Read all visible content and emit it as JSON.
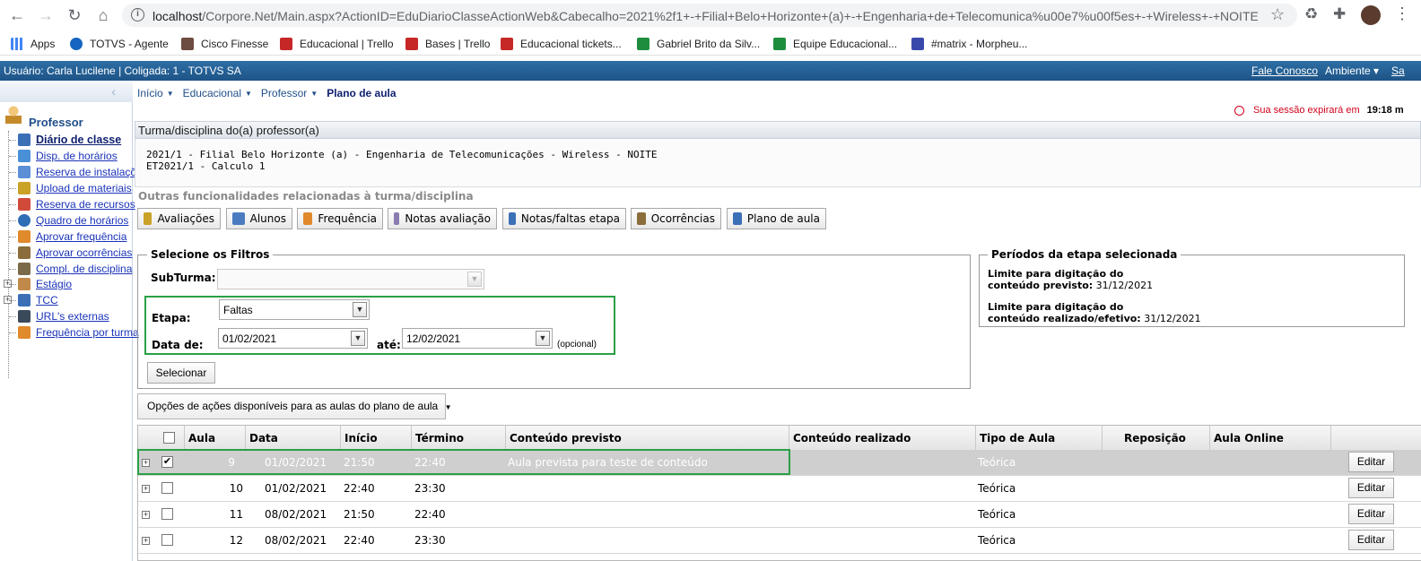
{
  "browser": {
    "url_host": "localhost",
    "url_rest": "/Corpore.Net/Main.aspx?ActionID=EduDiarioClasseActionWeb&Cabecalho=2021%2f1+-+Filial+Belo+Horizonte+(a)+-+Engenharia+de+Telecomunica%u00e7%u00f5es+-+Wireless+-+NOITE...",
    "bookmarks": [
      {
        "label": "Apps",
        "color": "#4285f4"
      },
      {
        "label": "TOTVS - Agente",
        "color": "#1565c0"
      },
      {
        "label": "Cisco Finesse",
        "color": "#6d4c41"
      },
      {
        "label": "Educacional | Trello",
        "color": "#c62828"
      },
      {
        "label": "Bases | Trello",
        "color": "#c62828"
      },
      {
        "label": "Educacional tickets...",
        "color": "#c62828"
      },
      {
        "label": "Gabriel Brito da Silv...",
        "color": "#1e8e3e"
      },
      {
        "label": "Equipe Educacional...",
        "color": "#1e8e3e"
      },
      {
        "label": "#matrix - Morpheu...",
        "color": "#3949ab"
      }
    ]
  },
  "header": {
    "user_info": "Usuário: Carla Lucilene  |  Coligada: 1 - TOTVS SA",
    "fale_conosco": "Fale Conosco",
    "ambiente": "Ambiente ▾",
    "sair": "Sa"
  },
  "sidebar": {
    "title": "Professor",
    "items": [
      {
        "label": "Diário de classe",
        "color": "#3b6fb6"
      },
      {
        "label": "Disp. de horários",
        "color": "#4a90d9"
      },
      {
        "label": "Reserva de instalaçõ",
        "color": "#5c8fd6"
      },
      {
        "label": "Upload de materiais",
        "color": "#c9a227"
      },
      {
        "label": "Reserva de recursos",
        "color": "#d04a3a"
      },
      {
        "label": "Quadro de horários",
        "color": "#2f6db5"
      },
      {
        "label": "Aprovar frequência",
        "color": "#e08a2c"
      },
      {
        "label": "Aprovar ocorrências",
        "color": "#8a6d3b"
      },
      {
        "label": "Compl. de disciplina",
        "color": "#7b6a4a"
      },
      {
        "label": "Estágio",
        "color": "#c28a4a"
      },
      {
        "label": "TCC",
        "color": "#3b6fb6"
      },
      {
        "label": "URL's externas",
        "color": "#3a4a5a"
      },
      {
        "label": "Frequência por turma",
        "color": "#e08a2c"
      }
    ]
  },
  "breadcrumb": {
    "inicio": "Início",
    "educacional": "Educacional",
    "professor": "Professor",
    "current": "Plano de aula"
  },
  "session": {
    "text": "Sua sessão expirará em",
    "time": "19:18 m"
  },
  "turma": {
    "header": "Turma/disciplina do(a) professor(a)",
    "line1": "2021/1 - Filial Belo Horizonte (a) - Engenharia de Telecomunicações - Wireless - NOITE",
    "line2": "ET2021/1 - Calculo 1"
  },
  "outras_label": "Outras funcionalidades relacionadas à turma/disciplina",
  "func_buttons": [
    {
      "label": "Avaliações",
      "color": "#c9a227"
    },
    {
      "label": "Alunos",
      "color": "#4a7bc0"
    },
    {
      "label": "Frequência",
      "color": "#e08a2c"
    },
    {
      "label": "Notas avaliação",
      "color": "#8a7bb0"
    },
    {
      "label": "Notas/faltas etapa",
      "color": "#3b6fb6"
    },
    {
      "label": "Ocorrências",
      "color": "#8a6d3b"
    },
    {
      "label": "Plano de aula",
      "color": "#3b6fb6"
    }
  ],
  "filtros": {
    "legend": "Selecione os Filtros",
    "subturma_label": "SubTurma:",
    "subturma_value": "",
    "etapa_label": "Etapa:",
    "etapa_value": "Faltas",
    "data_de_label": "Data de:",
    "data_de_value": "01/02/2021",
    "ate_label": "até:",
    "ate_value": "12/02/2021",
    "opcional": "(opcional)",
    "selecionar": "Selecionar"
  },
  "periodos": {
    "legend": "Períodos da etapa selecionada",
    "l1_bold": "Limite para digitação do",
    "l2_bold": "conteúdo previsto:",
    "l2_val": " 31/12/2021",
    "l3_bold": "Limite para digitação do",
    "l4_bold": "conteúdo realizado/efetivo:",
    "l4_val": " 31/12/2021"
  },
  "opcoes_label": "Opções de ações disponíveis para as aulas do plano de aula",
  "grid": {
    "columns": [
      "Aula",
      "Data",
      "Início",
      "Término",
      "Conteúdo previsto",
      "Conteúdo realizado",
      "Tipo de Aula",
      "Reposição",
      "Aula Online"
    ],
    "edit_label": "Editar",
    "rows": [
      {
        "aula": "9",
        "data": "01/02/2021",
        "inicio": "21:50",
        "termino": "22:40",
        "previsto": "Aula prevista para teste de conteúdo",
        "realizado": "",
        "tipo": "Teórica",
        "reposicao": "",
        "online": "",
        "checked": "✔"
      },
      {
        "aula": "10",
        "data": "01/02/2021",
        "inicio": "22:40",
        "termino": "23:30",
        "previsto": "",
        "realizado": "",
        "tipo": "Teórica",
        "reposicao": "",
        "online": "",
        "checked": ""
      },
      {
        "aula": "11",
        "data": "08/02/2021",
        "inicio": "21:50",
        "termino": "22:40",
        "previsto": "",
        "realizado": "",
        "tipo": "Teórica",
        "reposicao": "",
        "online": "",
        "checked": ""
      },
      {
        "aula": "12",
        "data": "08/02/2021",
        "inicio": "22:40",
        "termino": "23:30",
        "previsto": "",
        "realizado": "",
        "tipo": "Teórica",
        "reposicao": "",
        "online": "",
        "checked": ""
      }
    ]
  }
}
